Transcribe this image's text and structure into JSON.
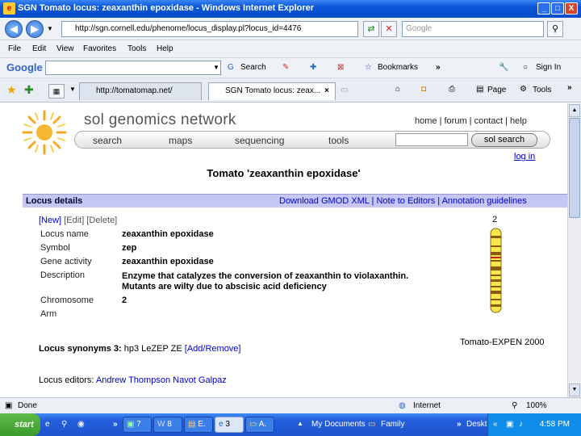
{
  "window": {
    "title": "SGN Tomato locus: zeaxanthin epoxidase - Windows Internet Explorer",
    "minimize": "_",
    "maximize": "□",
    "close": "X"
  },
  "nav": {
    "url": "http://sgn.cornell.edu/phenome/locus_display.pl?locus_id=4476",
    "search_placeholder": "Google"
  },
  "menu": {
    "items": [
      "File",
      "Edit",
      "View",
      "Favorites",
      "Tools",
      "Help"
    ]
  },
  "google_bar": {
    "logo": "Google",
    "search_label": "Search",
    "bookmarks_label": "Bookmarks",
    "more": "»",
    "signin": "Sign In"
  },
  "tabs": [
    {
      "label": "http://tomatomap.net/"
    },
    {
      "label": "SGN Tomato locus: zeax..."
    }
  ],
  "tab_tools": {
    "page": "Page",
    "tools": "Tools",
    "more": "»"
  },
  "site": {
    "brand": "sol genomics network",
    "top_links": "home | forum | contact | help",
    "nav": [
      "search",
      "maps",
      "sequencing",
      "tools"
    ],
    "sol_search": "sol search",
    "login": "log in"
  },
  "page": {
    "title": "Tomato 'zeaxanthin epoxidase'",
    "section": "Locus details",
    "section_links": [
      "Download GMOD XML",
      "Note to Editors",
      "Annotation guidelines"
    ],
    "edit_links": [
      "[New]",
      "[Edit]",
      "[Delete]"
    ],
    "fields": [
      {
        "label": "Locus name",
        "value": "zeaxanthin epoxidase"
      },
      {
        "label": "Symbol",
        "value": "zep"
      },
      {
        "label": "Gene activity",
        "value": "zeaxanthin epoxidase"
      },
      {
        "label": "Description",
        "value": "Enzyme that catalyzes the conversion of zeaxanthin to violaxanthin."
      },
      {
        "label": "",
        "value": "Mutants are wilty due to abscisic acid deficiency"
      },
      {
        "label": "Chromosome",
        "value": "2"
      },
      {
        "label": "Arm",
        "value": ""
      }
    ],
    "chromosome_number": "2",
    "map_label": "Tomato-EXPEN 2000",
    "synonyms_label": "Locus synonyms 3:",
    "synonyms_value": "hp3 LeZEP ZE",
    "synonyms_link": "[Add/Remove]",
    "editors_label": "Locus editors:",
    "editors_value": "Andrew Thompson Navot Galpaz"
  },
  "status": {
    "text": "Done",
    "zone": "Internet",
    "zoom": "100%"
  },
  "taskbar": {
    "start": "start",
    "buttons": [
      "7",
      "8",
      "E.",
      "3",
      "A."
    ],
    "mydocs": "My Documents",
    "family": "Family",
    "desktop": "Desktop",
    "more": "»",
    "time": "4:58 PM"
  },
  "colors": {
    "section_bar": "#c6c6f4",
    "link": "#0000cc",
    "titlebar": "#0a55d8",
    "taskbar": "#245edb"
  }
}
